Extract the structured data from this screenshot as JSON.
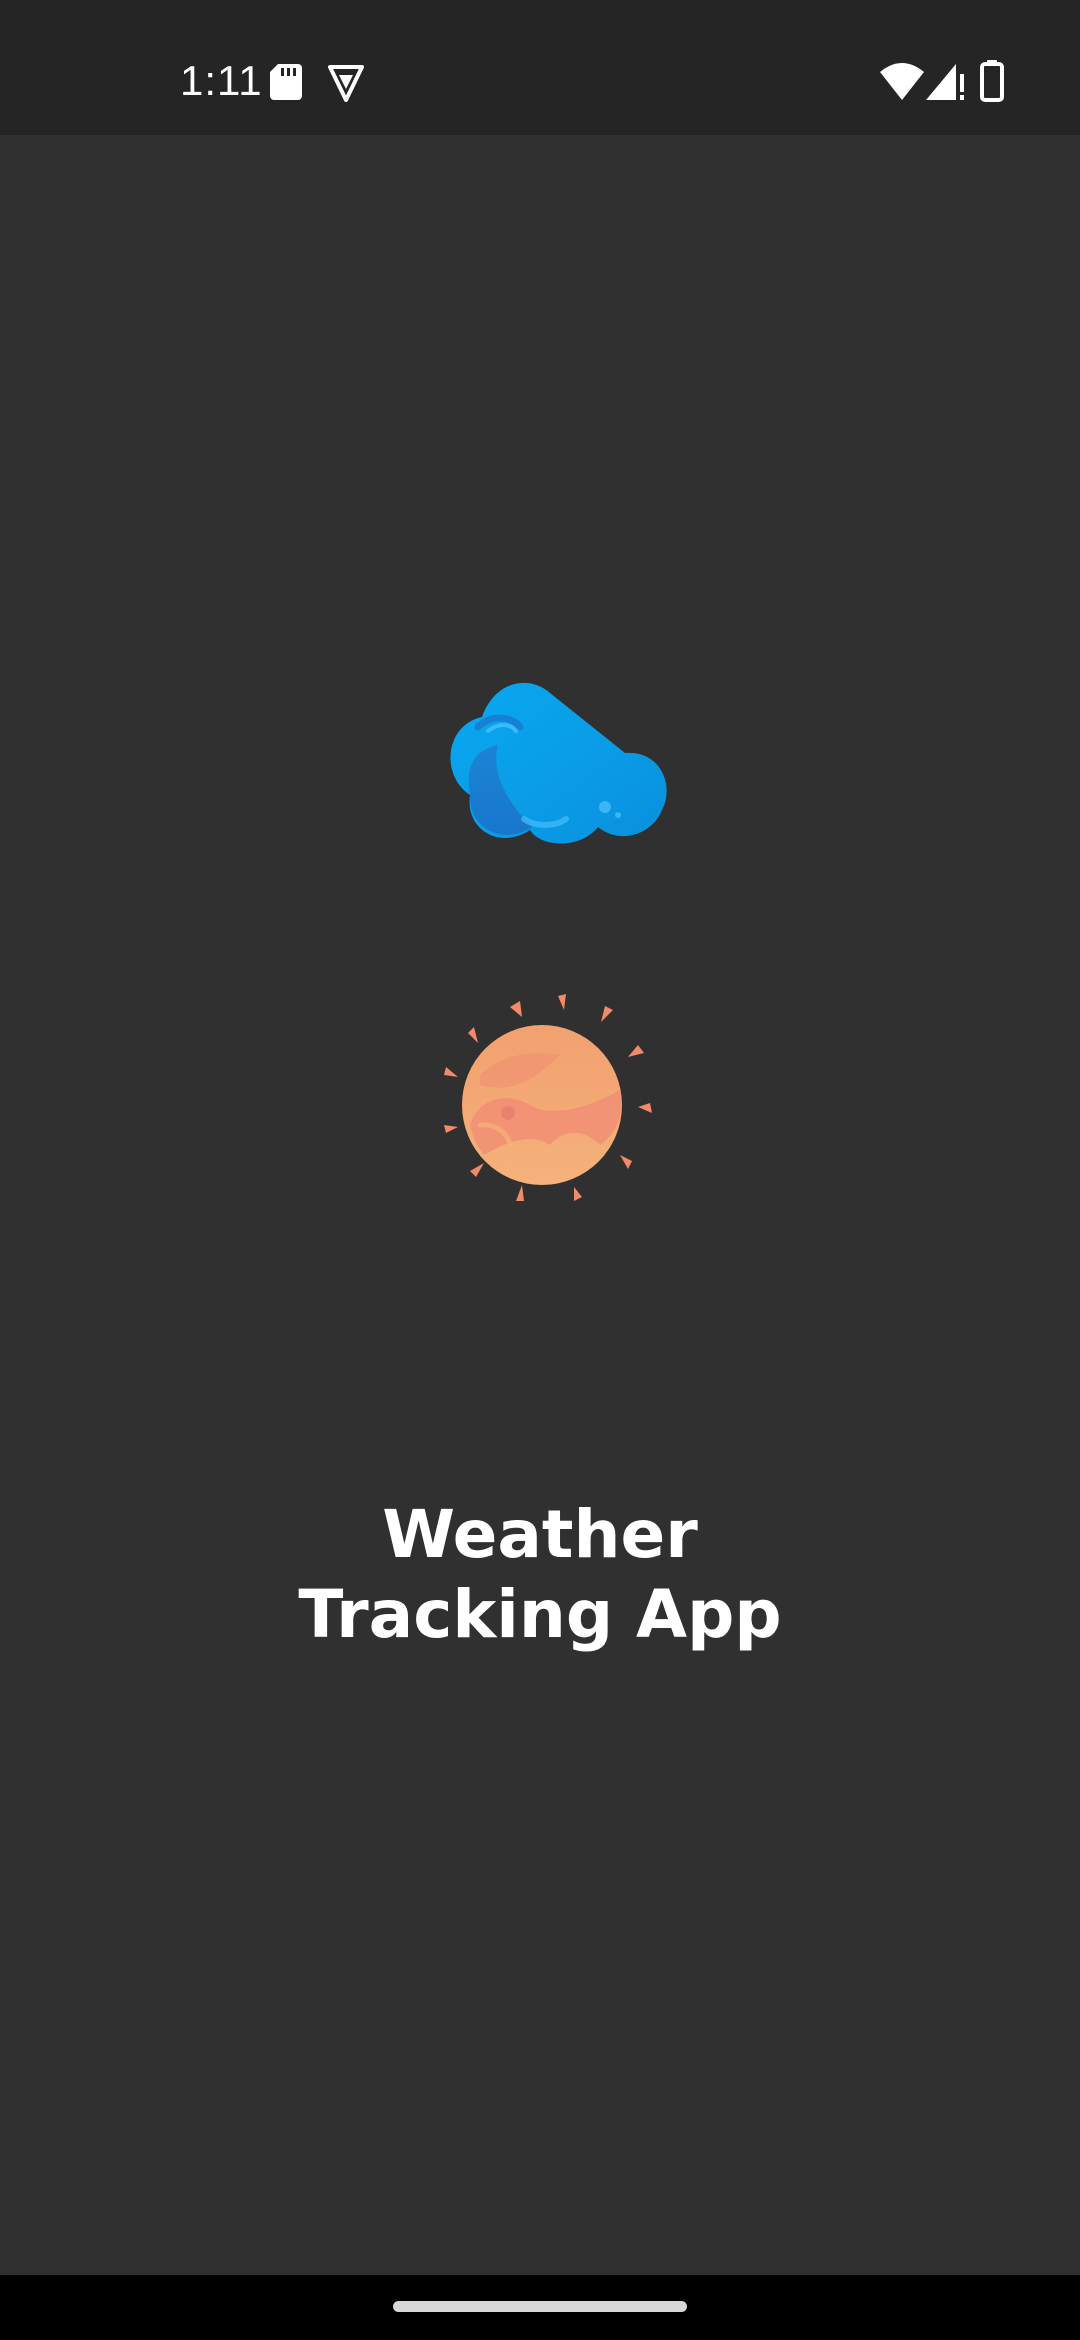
{
  "status_bar": {
    "time": "1:11",
    "left_icons": [
      "sd-card-icon",
      "vpn-shield-icon"
    ],
    "right_icons": [
      "wifi-icon",
      "cellular-signal-icon",
      "battery-icon"
    ]
  },
  "splash": {
    "logo_icon": "cloud-sun-icon",
    "title_line_1": "Weather",
    "title_line_2": "Tracking App"
  },
  "colors": {
    "background": "#303030",
    "status_bar": "#252525",
    "nav_bar": "#000000",
    "cloud_blue": "#0aa0e8",
    "sun_orange": "#f0a070",
    "title_text": "#ffffff"
  },
  "nav": {
    "handle": "home-gesture-handle"
  }
}
